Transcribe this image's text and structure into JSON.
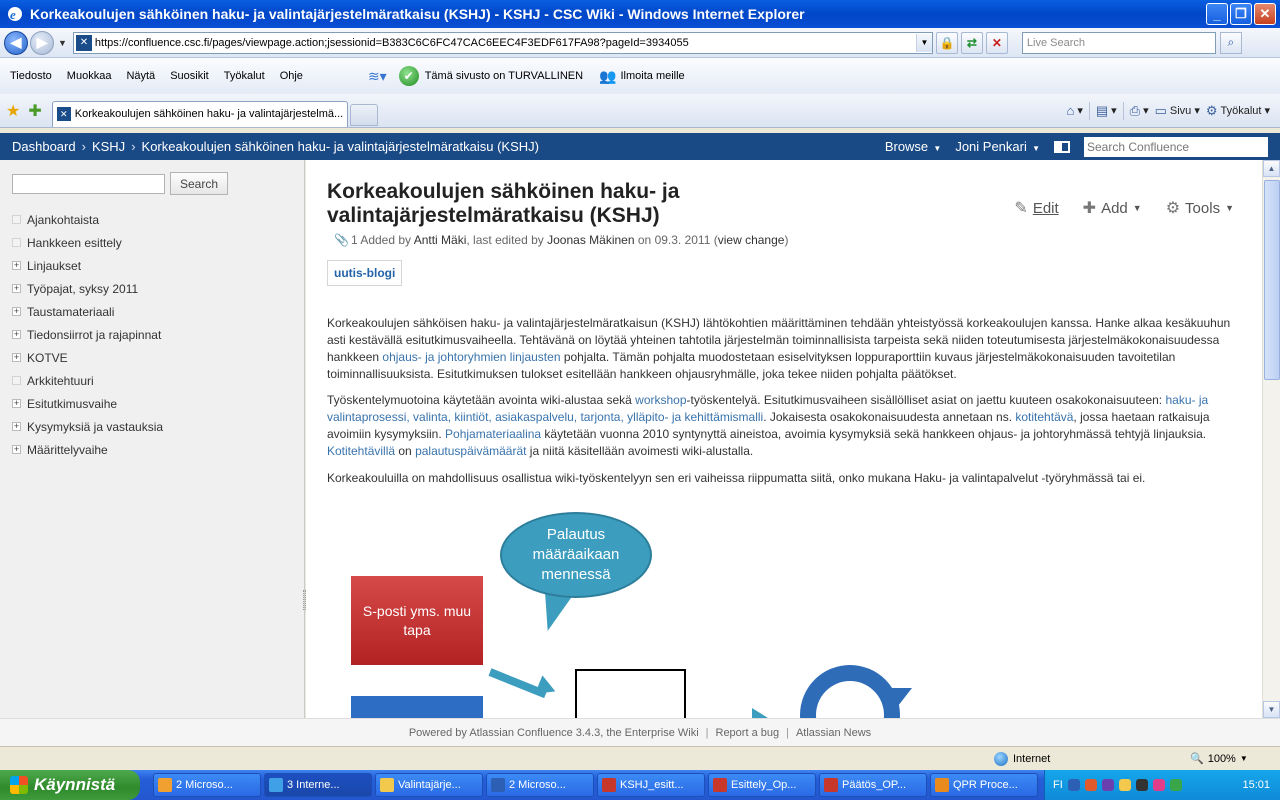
{
  "window": {
    "title": "Korkeakoulujen sähköinen haku- ja valintajärjestelmäratkaisu (KSHJ) - KSHJ - CSC Wiki - Windows Internet Explorer"
  },
  "address": {
    "url": "https://confluence.csc.fi/pages/viewpage.action;jsessionid=B383C6C6FC47CAC6EEC4F3EDF617FA98?pageId=3934055",
    "live_search_placeholder": "Live Search"
  },
  "menubar": {
    "items": [
      "Tiedosto",
      "Muokkaa",
      "Näytä",
      "Suosikit",
      "Työkalut",
      "Ohje"
    ],
    "safe_site": "Tämä sivusto on TURVALLINEN",
    "notify": "Ilmoita meille"
  },
  "tabs": {
    "active_title": "Korkeakoulujen sähköinen haku- ja valintajärjestelmä...",
    "cmd_page": "Sivu",
    "cmd_tools": "Työkalut"
  },
  "confluence_header": {
    "breadcrumbs": [
      "Dashboard",
      "KSHJ",
      "Korkeakoulujen sähköinen haku- ja valintajärjestelmäratkaisu (KSHJ)"
    ],
    "browse": "Browse",
    "user": "Joni Penkari",
    "search_placeholder": "Search Confluence"
  },
  "sidebar": {
    "search_button": "Search",
    "items": [
      {
        "label": "Ajankohtaista",
        "expandable": false
      },
      {
        "label": "Hankkeen esittely",
        "expandable": false
      },
      {
        "label": "Linjaukset",
        "expandable": true
      },
      {
        "label": "Työpajat, syksy 2011",
        "expandable": true
      },
      {
        "label": "Taustamateriaali",
        "expandable": true
      },
      {
        "label": "Tiedonsiirrot ja rajapinnat",
        "expandable": true
      },
      {
        "label": "KOTVE",
        "expandable": true
      },
      {
        "label": "Arkkitehtuuri",
        "expandable": false
      },
      {
        "label": "Esitutkimusvaihe",
        "expandable": true
      },
      {
        "label": "Kysymyksiä ja vastauksia",
        "expandable": true
      },
      {
        "label": "Määrittelyvaihe",
        "expandable": true
      }
    ]
  },
  "page": {
    "title": "Korkeakoulujen sähköinen haku- ja valintajärjestelmäratkaisu (KSHJ)",
    "actions": {
      "edit": "Edit",
      "add": "Add",
      "tools": "Tools"
    },
    "meta": {
      "attachments": "1",
      "added_by_label": "Added by",
      "added_by": "Antti Mäki",
      "edited_label": ", last edited by",
      "edited_by": "Joonas Mäkinen",
      "on_label": "on",
      "date": "09.3. 2011",
      "view_change": "view change"
    },
    "label_tag": "uutis-blogi",
    "p1": {
      "t1": "Korkeakoulujen sähköisen haku- ja valintajärjestelmäratkaisun (KSHJ) lähtökohtien määrittäminen tehdään yhteistyössä korkeakoulujen kanssa. Hanke alkaa kesäkuuhun asti kestävällä esitutkimusvaiheella. Tehtävänä on löytää yhteinen tahtotila järjestelmän toiminnallisista tarpeista sekä niiden toteutumisesta järjestelmäkokonaisuudessa hankkeen ",
      "link1": "ohjaus- ja johtoryhmien linjausten",
      "t2": " pohjalta. Tämän pohjalta muodostetaan esiselvityksen loppuraporttiin kuvaus järjestelmäkokonaisuuden tavoitetilan toiminnallisuuksista. Esitutkimuksen tulokset esitellään hankkeen ohjausryhmälle, joka tekee niiden pohjalta päätökset."
    },
    "p2": {
      "t1": "Työskentelymuotoina käytetään avointa wiki-alustaa sekä ",
      "link1": "workshop",
      "t2": "-työskentelyä. Esitutkimusvaiheen sisällölliset asiat on jaettu kuuteen osakokonaisuuteen: ",
      "link2": "haku- ja valintaprosessi, valinta, kiintiöt, asiakaspalvelu, tarjonta, ylläpito- ja kehittämismalli",
      "t3": ". Jokaisesta osakokonaisuudesta annetaan ns. ",
      "link3": "kotitehtävä",
      "t4": ", jossa haetaan ratkaisuja avoimiin kysymyksiin. ",
      "link4": "Pohjamateriaalina",
      "t5": " käytetään vuonna 2010 syntynyttä aineistoa, avoimia kysymyksiä sekä hankkeen ohjaus- ja johtoryhmässä tehtyjä linjauksia. ",
      "link5": "Kotitehtävillä",
      "t6": " on ",
      "link6": "palautuspäivämäärät",
      "t7": " ja niitä käsitellään avoimesti wiki-alustalla."
    },
    "p3": "Korkeakouluilla on mahdollisuus osallistua wiki-työskentelyyn sen eri vaiheissa riippumatta siitä, onko mukana Haku- ja valintapalvelut -työryhmässä tai ei.",
    "diagram": {
      "bubble": "Palautus määräaikaan mennessä",
      "redbox": "S-posti yms. muu tapa"
    }
  },
  "footer": {
    "powered": "Powered by Atlassian Confluence 3.4.3, the Enterprise Wiki",
    "report": "Report a bug",
    "news": "Atlassian News"
  },
  "statusbar": {
    "zone": "Internet",
    "zoom": "100%"
  },
  "taskbar": {
    "start": "Käynnistä",
    "tasks": [
      {
        "label": "2 Microso...",
        "color": "#f0a030"
      },
      {
        "label": "3 Interne...",
        "color": "#3fa0e8"
      },
      {
        "label": "Valintajärje...",
        "color": "#f2c94c"
      },
      {
        "label": "2 Microso...",
        "color": "#2d5fb4"
      },
      {
        "label": "KSHJ_esitt...",
        "color": "#c8382a"
      },
      {
        "label": "Esittely_Op...",
        "color": "#c8382a"
      },
      {
        "label": "Päätös_OP...",
        "color": "#c8382a"
      },
      {
        "label": "QPR Proce...",
        "color": "#e88b1c"
      }
    ],
    "lang": "FI",
    "clock": "15:01"
  }
}
